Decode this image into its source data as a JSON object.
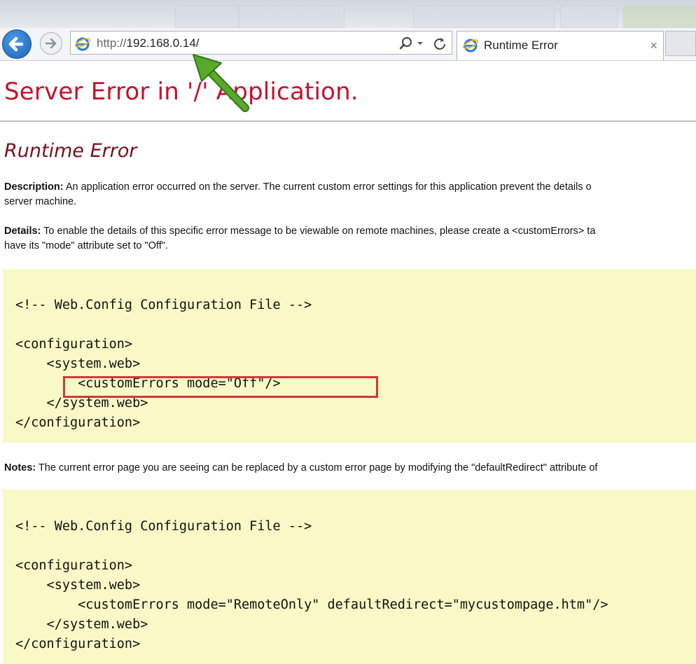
{
  "browser": {
    "url_protocol": "http://",
    "url_host": "192.168.0.14/",
    "tab_title": "Runtime Error",
    "tab_close": "×",
    "icons": [
      "back-arrow-icon",
      "forward-arrow-icon",
      "ie-logo-icon",
      "search-icon",
      "dropdown-icon",
      "refresh-icon",
      "close-icon"
    ]
  },
  "page": {
    "title": "Server Error in '/' Application.",
    "subtitle": "Runtime Error",
    "description_label": "Description:",
    "description_text_1": " An application error occurred on the server. The current custom error settings for this application prevent the details o",
    "description_text_2": "server machine.",
    "details_label": "Details:",
    "details_text_1": " To enable the details of this specific error message to be viewable on remote machines, please create a <customErrors> ta",
    "details_text_2": "have its \"mode\" attribute set to \"Off\".",
    "code1": [
      "<!-- Web.Config Configuration File -->",
      "<configuration>",
      "    <system.web>",
      "        <customErrors mode=\"Off\"/>",
      "    </system.web>",
      "</configuration>"
    ],
    "notes_label": "Notes:",
    "notes_text": " The current error page you are seeing can be replaced by a custom error page by modifying the \"defaultRedirect\" attribute of",
    "code2": [
      "<!-- Web.Config Configuration File -->",
      "<configuration>",
      "    <system.web>",
      "        <customErrors mode=\"RemoteOnly\" defaultRedirect=\"mycustompage.htm\"/>",
      "    </system.web>",
      "</configuration>"
    ]
  },
  "colors": {
    "title": "#c8102e",
    "subtitle": "#7a0f1e",
    "code_bg": "#f9f9c7",
    "highlight_box": "#d0393b",
    "annotation_arrow": "#5aa82c"
  }
}
